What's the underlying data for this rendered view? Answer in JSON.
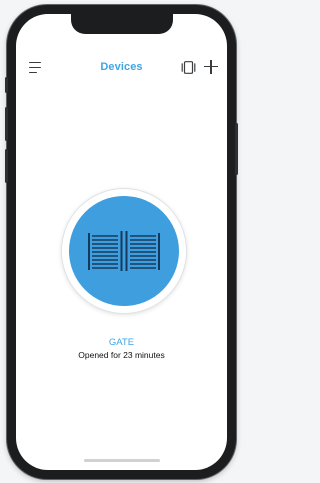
{
  "header": {
    "title": "Devices",
    "menu_icon": "hamburger-menu-icon",
    "view_icon": "tablet-view-icon",
    "add_icon": "plus-icon"
  },
  "device": {
    "name": "GATE",
    "status": "Opened for 23 minutes",
    "icon": "gate-icon",
    "state": "open"
  },
  "colors": {
    "accent": "#3ea6e6",
    "device_fill": "#3f9fde",
    "gate_lines": "#163a5e"
  }
}
